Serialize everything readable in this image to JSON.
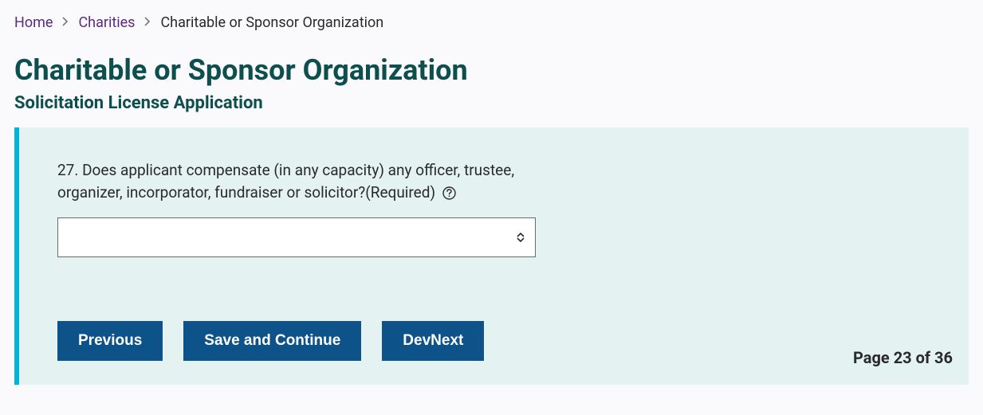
{
  "breadcrumb": {
    "home": "Home",
    "charities": "Charities",
    "current": "Charitable or Sponsor Organization"
  },
  "header": {
    "title": "Charitable or Sponsor Organization",
    "subtitle": "Solicitation License Application"
  },
  "form": {
    "question_text": "27. Does applicant compensate (in any capacity) any officer, trustee, organizer, incorporator, fundraiser or solicitor?(Required)",
    "select_value": ""
  },
  "buttons": {
    "previous": "Previous",
    "save_continue": "Save and Continue",
    "devnext": "DevNext"
  },
  "pagination": {
    "text": "Page 23 of 36"
  }
}
